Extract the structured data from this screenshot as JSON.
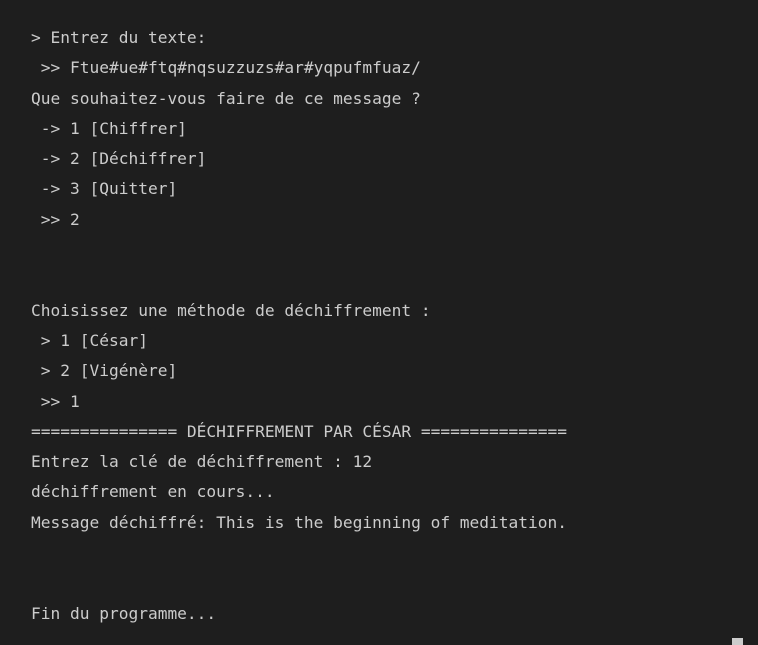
{
  "terminal": {
    "lines": [
      "> Entrez du texte:",
      " >> Ftue#ue#ftq#nqsuzzuzs#ar#yqpufmfuaz/",
      "Que souhaitez-vous faire de ce message ?",
      " -> 1 [Chiffrer]",
      " -> 2 [Déchiffrer]",
      " -> 3 [Quitter]",
      " >> 2",
      "",
      "",
      "Choisissez une méthode de déchiffrement :",
      " > 1 [César]",
      " > 2 [Vigénère]",
      " >> 1",
      "=============== DÉCHIFFREMENT PAR CÉSAR ===============",
      "Entrez la clé de déchiffrement : 12",
      "déchiffrement en cours...",
      "Message déchiffré: This is the beginning of meditation.",
      "",
      "",
      "Fin du programme..."
    ]
  }
}
